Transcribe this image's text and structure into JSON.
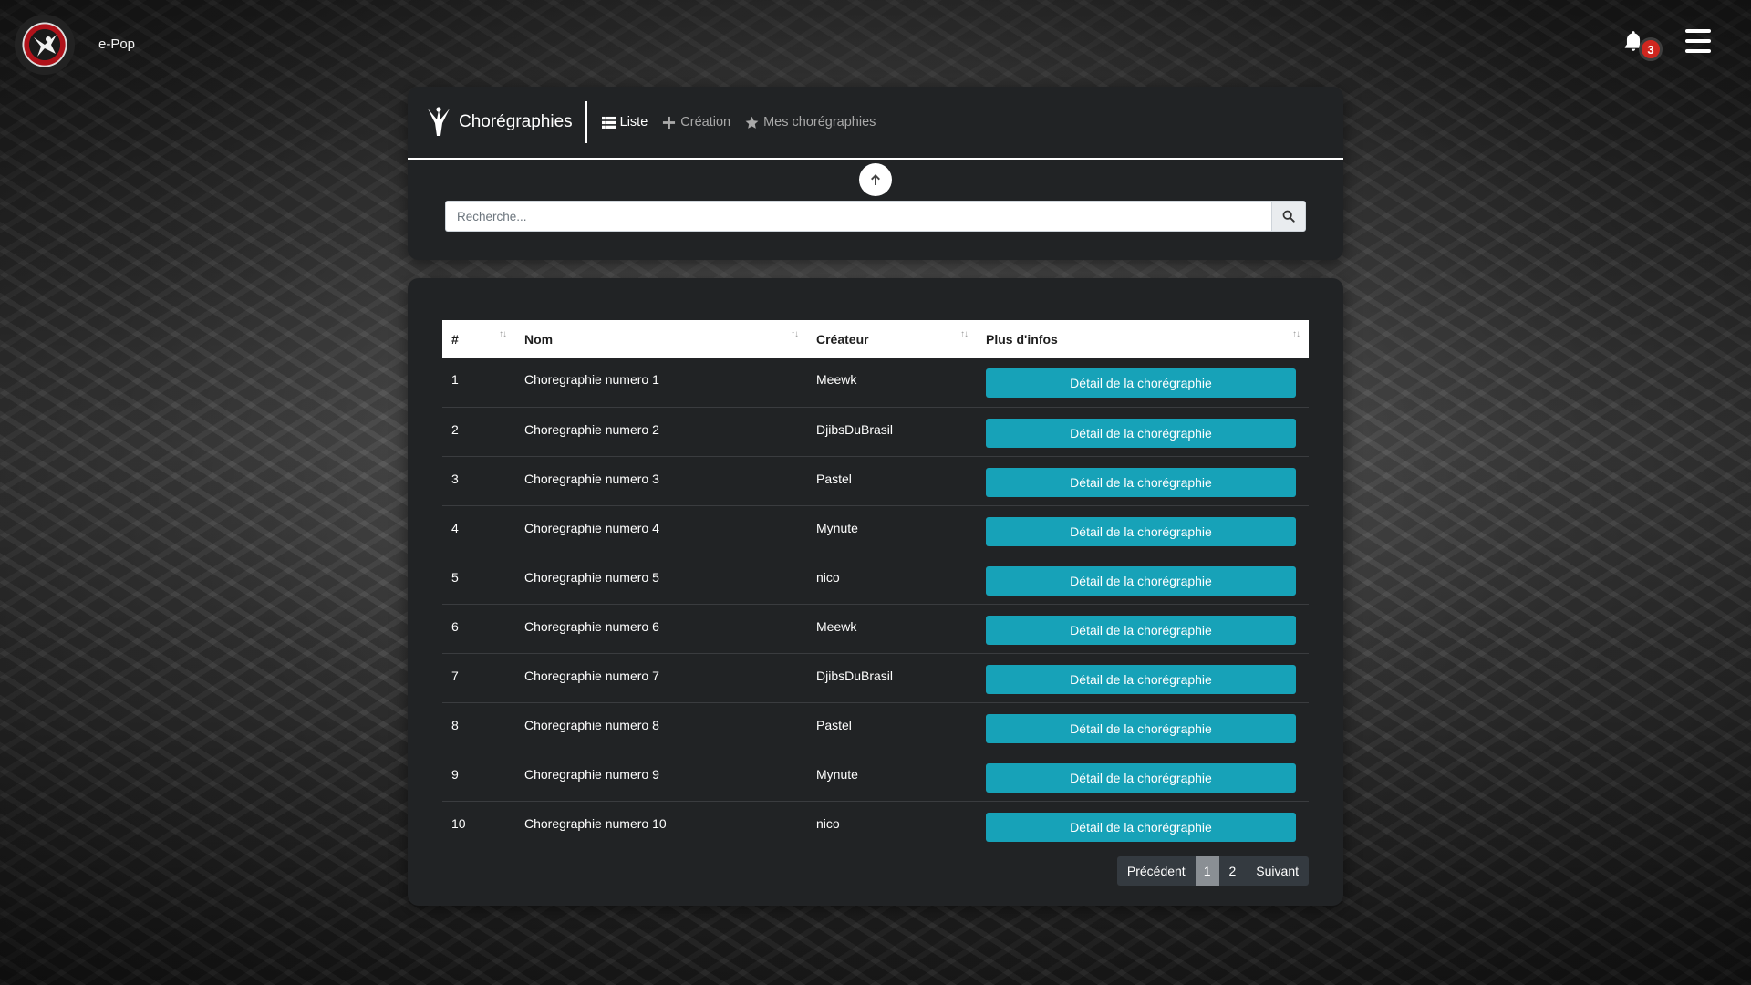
{
  "app": {
    "brand": "e-Pop",
    "notification_count": "3"
  },
  "header": {
    "section_title": "Chorégraphies",
    "nav": [
      {
        "label": "Liste",
        "icon": "list-icon",
        "active": true
      },
      {
        "label": "Création",
        "icon": "plus-icon",
        "active": false
      },
      {
        "label": "Mes chorégraphies",
        "icon": "star-icon",
        "active": false
      }
    ]
  },
  "search": {
    "placeholder": "Recherche...",
    "value": ""
  },
  "table": {
    "columns": [
      "#",
      "Nom",
      "Créateur",
      "Plus d'infos"
    ],
    "rows": [
      {
        "num": "1",
        "nom": "Choregraphie numero 1",
        "createur": "Meewk",
        "action": "Détail de la chorégraphie"
      },
      {
        "num": "2",
        "nom": "Choregraphie numero 2",
        "createur": "DjibsDuBrasil",
        "action": "Détail de la chorégraphie"
      },
      {
        "num": "3",
        "nom": "Choregraphie numero 3",
        "createur": "Pastel",
        "action": "Détail de la chorégraphie"
      },
      {
        "num": "4",
        "nom": "Choregraphie numero 4",
        "createur": "Mynute",
        "action": "Détail de la chorégraphie"
      },
      {
        "num": "5",
        "nom": "Choregraphie numero 5",
        "createur": "nico",
        "action": "Détail de la chorégraphie"
      },
      {
        "num": "6",
        "nom": "Choregraphie numero 6",
        "createur": "Meewk",
        "action": "Détail de la chorégraphie"
      },
      {
        "num": "7",
        "nom": "Choregraphie numero 7",
        "createur": "DjibsDuBrasil",
        "action": "Détail de la chorégraphie"
      },
      {
        "num": "8",
        "nom": "Choregraphie numero 8",
        "createur": "Pastel",
        "action": "Détail de la chorégraphie"
      },
      {
        "num": "9",
        "nom": "Choregraphie numero 9",
        "createur": "Mynute",
        "action": "Détail de la chorégraphie"
      },
      {
        "num": "10",
        "nom": "Choregraphie numero 10",
        "createur": "nico",
        "action": "Détail de la chorégraphie"
      }
    ]
  },
  "pagination": {
    "prev_label": "Précédent",
    "pages": [
      "1",
      "2"
    ],
    "current": "1",
    "next_label": "Suivant"
  },
  "colors": {
    "accent": "#17a2b8",
    "card_bg": "#212325",
    "badge": "#d0261f"
  }
}
